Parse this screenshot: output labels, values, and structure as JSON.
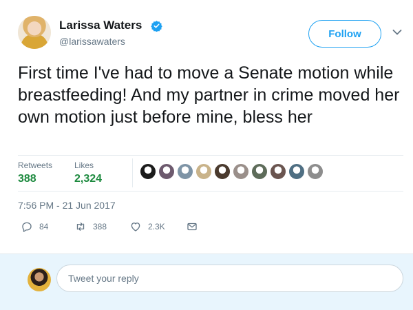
{
  "user": {
    "display_name": "Larissa Waters",
    "handle": "@larissawaters",
    "verified": true
  },
  "follow_button": {
    "label": "Follow"
  },
  "tweet": {
    "text": "First time I've had to move a Senate motion while breastfeeding! And my partner in crime moved her own motion just before mine, bless her",
    "timestamp": "7:56 PM - 21 Jun 2017"
  },
  "stats": {
    "retweets_label": "Retweets",
    "retweets_value": "388",
    "likes_label": "Likes",
    "likes_value": "2,324"
  },
  "liker_avatars": [
    "#1b1b1b",
    "#6d5a6e",
    "#7e94a6",
    "#c9b38a",
    "#4a3a2e",
    "#9a8f8a",
    "#5e6c5a",
    "#6a5550",
    "#4f6f83",
    "#8d8d8d"
  ],
  "actions": {
    "reply_count": "84",
    "retweet_count": "388",
    "like_count": "2.3K"
  },
  "reply_bar": {
    "placeholder": "Tweet your reply"
  },
  "colors": {
    "accent": "#1da1f2",
    "stat_value": "#1d8a3f",
    "muted": "#657786",
    "reply_bar_bg": "#e8f5fd"
  },
  "icons": [
    "verified-icon",
    "chevron-down-icon",
    "reply-icon",
    "retweet-icon",
    "like-icon",
    "direct-message-icon"
  ]
}
